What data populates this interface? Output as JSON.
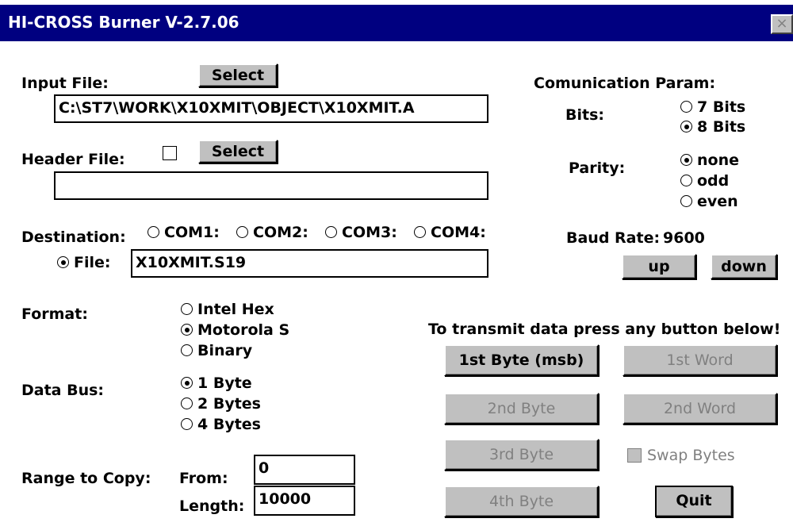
{
  "window": {
    "title": "HI-CROSS Burner V-2.7.06",
    "close_glyph": "×"
  },
  "input_file": {
    "label": "Input File:",
    "select_label": "Select",
    "value": "C:\\ST7\\WORK\\X10XMIT\\OBJECT\\X10XMIT.A"
  },
  "header_file": {
    "label": "Header File:",
    "select_label": "Select",
    "value": "",
    "checked": false
  },
  "destination": {
    "label": "Destination:",
    "ports": [
      "COM1:",
      "COM2:",
      "COM3:",
      "COM4:"
    ],
    "file_label": "File:",
    "file_value": "X10XMIT.S19",
    "selected": "File:"
  },
  "format": {
    "label": "Format:",
    "options": [
      "Intel Hex",
      "Motorola S",
      "Binary"
    ],
    "selected": "Motorola S"
  },
  "data_bus": {
    "label": "Data Bus:",
    "options": [
      "1 Byte",
      "2 Bytes",
      "4 Bytes"
    ],
    "selected": "1 Byte"
  },
  "range": {
    "label": "Range to Copy:",
    "from_label": "From:",
    "from_value": "0",
    "length_label": "Length:",
    "length_value": "10000"
  },
  "comm": {
    "title": "Comunication Param:",
    "bits_label": "Bits:",
    "bits_options": [
      "7 Bits",
      "8 Bits"
    ],
    "bits_selected": "8 Bits",
    "parity_label": "Parity:",
    "parity_options": [
      "none",
      "odd",
      "even"
    ],
    "parity_selected": "none",
    "baud_label": "Baud Rate:",
    "baud_value": "9600",
    "up_label": "up",
    "down_label": "down"
  },
  "transmit": {
    "instruction": "To transmit data press any button below!",
    "byte1": "1st Byte (msb)",
    "word1": "1st Word",
    "byte2": "2nd Byte",
    "word2": "2nd Word",
    "byte3": "3rd Byte",
    "swap": "Swap Bytes",
    "byte4": "4th Byte",
    "quit": "Quit"
  },
  "colors": {
    "titlebar": "#000080",
    "face": "#c0c0c0",
    "disabled_text": "#808080"
  }
}
